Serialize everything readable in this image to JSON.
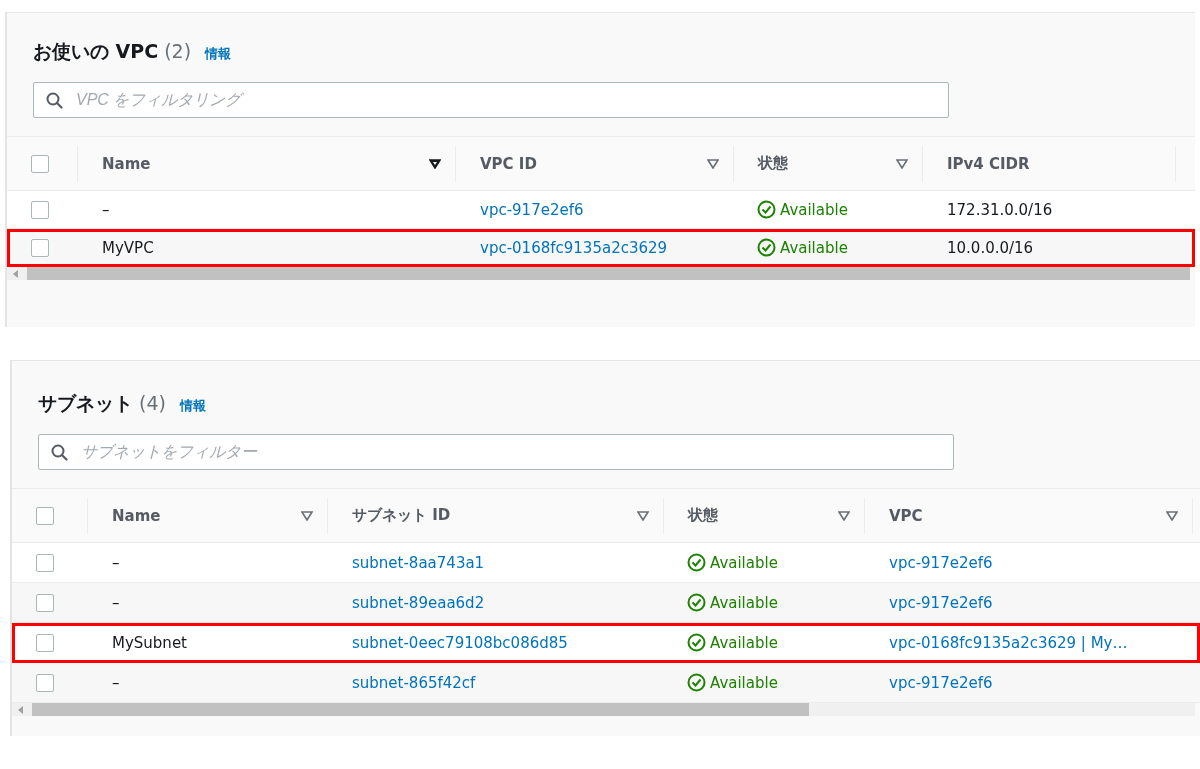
{
  "panels": [
    {
      "title": "お使いの VPC",
      "count": "(2)",
      "info": "情報",
      "search": {
        "placeholder": "VPC をフィルタリング"
      },
      "columns": [
        {
          "label": "Name",
          "sorted": true
        },
        {
          "label": "VPC ID",
          "sorted": false
        },
        {
          "label": "状態",
          "sorted": false
        },
        {
          "label": "IPv4 CIDR"
        }
      ],
      "all_checked": false,
      "rows": [
        {
          "checked": false,
          "highlighted": false,
          "cells": [
            {
              "kind": "text",
              "text": "–"
            },
            {
              "kind": "link",
              "text": "vpc-917e2ef6"
            },
            {
              "kind": "status",
              "text": "Available"
            },
            {
              "kind": "text",
              "text": "172.31.0.0/16"
            }
          ]
        },
        {
          "checked": false,
          "highlighted": true,
          "cells": [
            {
              "kind": "text",
              "text": "MyVPC"
            },
            {
              "kind": "link",
              "text": "vpc-0168fc9135a2c3629"
            },
            {
              "kind": "status",
              "text": "Available"
            },
            {
              "kind": "text",
              "text": "10.0.0.0/16"
            }
          ]
        }
      ]
    },
    {
      "title": "サブネット",
      "count": "(4)",
      "info": "情報",
      "search": {
        "placeholder": "サブネットをフィルター"
      },
      "columns": [
        {
          "label": "Name",
          "sorted": false
        },
        {
          "label": "サブネット ID",
          "sorted": false
        },
        {
          "label": "状態",
          "sorted": false
        },
        {
          "label": "VPC",
          "sorted": false
        }
      ],
      "all_checked": false,
      "rows": [
        {
          "checked": false,
          "highlighted": false,
          "cells": [
            {
              "kind": "text",
              "text": "–"
            },
            {
              "kind": "link",
              "text": "subnet-8aa743a1"
            },
            {
              "kind": "status",
              "text": "Available"
            },
            {
              "kind": "link",
              "text": "vpc-917e2ef6"
            }
          ]
        },
        {
          "checked": false,
          "highlighted": false,
          "cells": [
            {
              "kind": "text",
              "text": "–"
            },
            {
              "kind": "link",
              "text": "subnet-89eaa6d2"
            },
            {
              "kind": "status",
              "text": "Available"
            },
            {
              "kind": "link",
              "text": "vpc-917e2ef6"
            }
          ]
        },
        {
          "checked": false,
          "highlighted": true,
          "cells": [
            {
              "kind": "text",
              "text": "MySubnet"
            },
            {
              "kind": "link",
              "text": "subnet-0eec79108bc086d85"
            },
            {
              "kind": "status",
              "text": "Available"
            },
            {
              "kind": "link",
              "text": "vpc-0168fc9135a2c3629 | My…"
            }
          ]
        },
        {
          "checked": false,
          "highlighted": false,
          "cells": [
            {
              "kind": "text",
              "text": "–"
            },
            {
              "kind": "link",
              "text": "subnet-865f42cf"
            },
            {
              "kind": "status",
              "text": "Available"
            },
            {
              "kind": "link",
              "text": "vpc-917e2ef6"
            }
          ]
        }
      ]
    }
  ]
}
